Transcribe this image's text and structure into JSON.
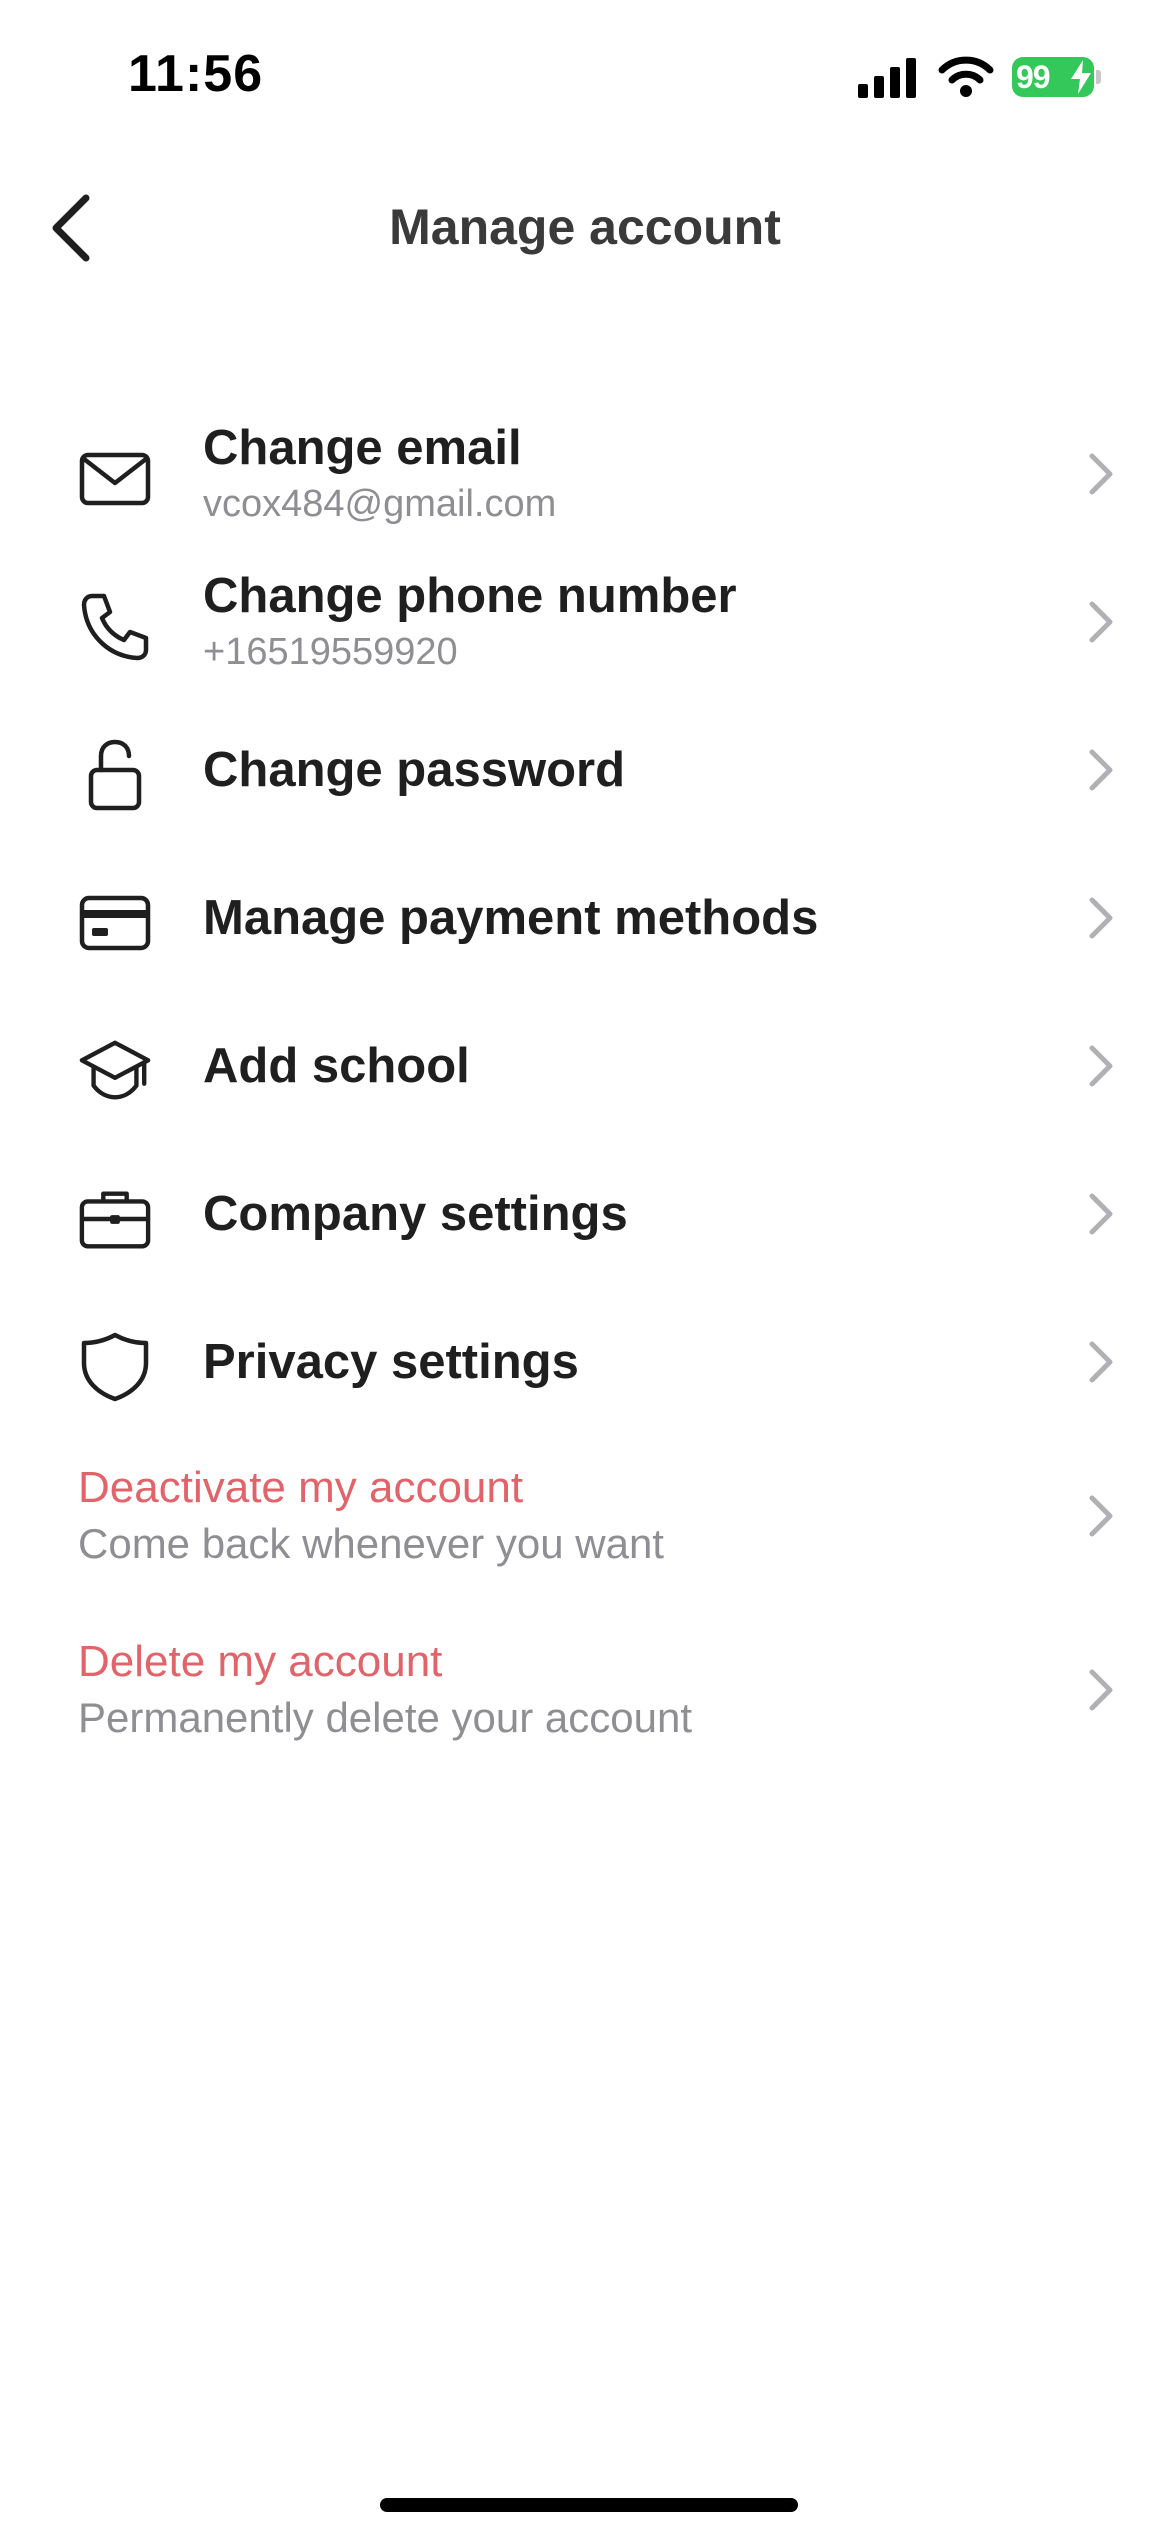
{
  "status_bar": {
    "time": "11:56",
    "battery_level": "99",
    "battery_color": "#34c759",
    "icons": [
      "signal-icon",
      "wifi-icon",
      "battery-icon"
    ]
  },
  "nav": {
    "title": "Manage account",
    "back_icon": "chevron-left-icon"
  },
  "menu": {
    "items": [
      {
        "icon": "envelope-icon",
        "label": "Change email",
        "sub": "vcox484@gmail.com"
      },
      {
        "icon": "phone-icon",
        "label": "Change phone number",
        "sub": "+16519559920"
      },
      {
        "icon": "lock-icon",
        "label": "Change password"
      },
      {
        "icon": "credit-card-icon",
        "label": "Manage payment methods"
      },
      {
        "icon": "graduation-cap-icon",
        "label": "Add school"
      },
      {
        "icon": "briefcase-icon",
        "label": "Company settings"
      },
      {
        "icon": "shield-icon",
        "label": "Privacy settings"
      }
    ]
  },
  "danger": {
    "color": "#e0646a",
    "items": [
      {
        "label": "Deactivate my account",
        "sub": "Come back whenever you want"
      },
      {
        "label": "Delete my account",
        "sub": "Permanently delete your account"
      }
    ]
  }
}
